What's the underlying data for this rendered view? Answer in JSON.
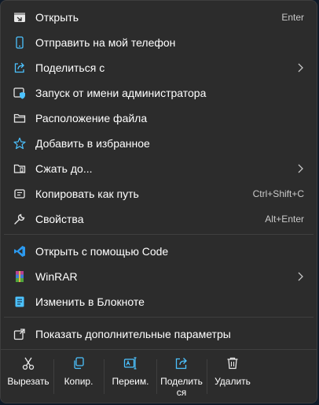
{
  "colors": {
    "accent": "#4cc2ff",
    "background": "#2c2c2c",
    "text": "#ffffff",
    "muted": "#c9c9c9",
    "separator": "#3f3f3f"
  },
  "menu": {
    "items": [
      {
        "label": "Открыть",
        "shortcut": "Enter",
        "icon": "open-window-icon"
      },
      {
        "label": "Отправить на мой телефон",
        "icon": "phone-icon"
      },
      {
        "label": "Поделиться с",
        "icon": "share-icon",
        "submenu": true
      },
      {
        "label": "Запуск от имени администратора",
        "icon": "admin-shield-icon"
      },
      {
        "label": "Расположение файла",
        "icon": "folder-icon"
      },
      {
        "label": "Добавить в избранное",
        "icon": "star-icon"
      },
      {
        "label": "Сжать до...",
        "icon": "compress-folder-icon",
        "submenu": true
      },
      {
        "label": "Копировать как путь",
        "shortcut": "Ctrl+Shift+C",
        "icon": "copy-path-icon"
      },
      {
        "label": "Свойства",
        "shortcut": "Alt+Enter",
        "icon": "wrench-icon"
      }
    ],
    "apps": [
      {
        "label": "Открыть с помощью Code",
        "icon": "vscode-icon"
      },
      {
        "label": "WinRAR",
        "icon": "winrar-icon",
        "submenu": true
      },
      {
        "label": "Изменить в Блокноте",
        "icon": "notepad-icon"
      }
    ],
    "more": {
      "label": "Показать дополнительные параметры",
      "icon": "more-options-icon"
    }
  },
  "actions": [
    {
      "label": "Вырезать",
      "icon": "scissors-icon"
    },
    {
      "label": "Копир.",
      "icon": "copy-icon"
    },
    {
      "label": "Переим.",
      "icon": "rename-icon"
    },
    {
      "label": "Поделиться",
      "icon": "share-icon"
    },
    {
      "label": "Удалить",
      "icon": "trash-icon"
    }
  ]
}
